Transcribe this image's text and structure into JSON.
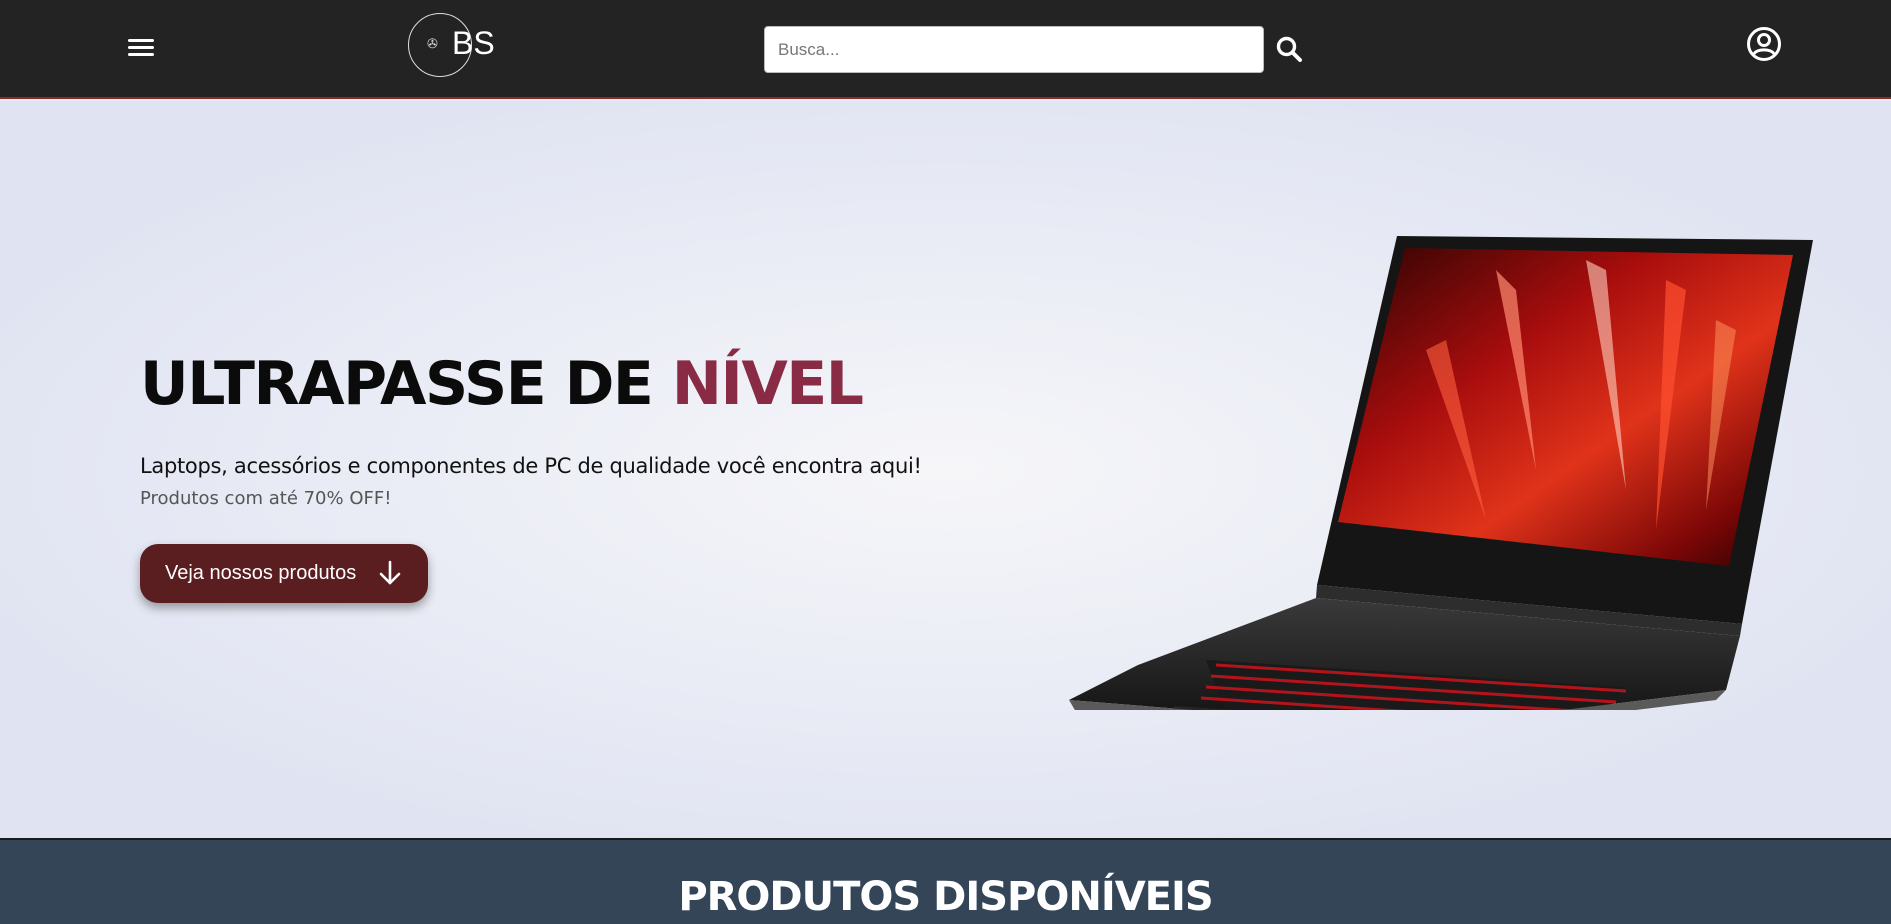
{
  "header": {
    "logo_text": "BS",
    "logo_mark": "✇",
    "search_placeholder": "Busca...",
    "menu_icon": "hamburger-menu-icon",
    "search_icon": "search-icon",
    "account_icon": "user-circle-icon"
  },
  "hero": {
    "title_main": "ULTRAPASSE DE ",
    "title_accent": "NÍVEL",
    "subtitle": "Laptops, acessórios e componentes de PC de qualidade você encontra aqui!",
    "promo": "Produtos com até 70% OFF!",
    "cta_label": "Veja nossos produtos",
    "cta_icon": "arrow-down-icon",
    "image": "laptop-image"
  },
  "products": {
    "title": "PRODUTOS DISPONÍVEIS"
  },
  "colors": {
    "header_bg": "#232323",
    "accent": "#8a2b45",
    "cta_bg": "#5a1d20",
    "products_bg": "#344558"
  }
}
